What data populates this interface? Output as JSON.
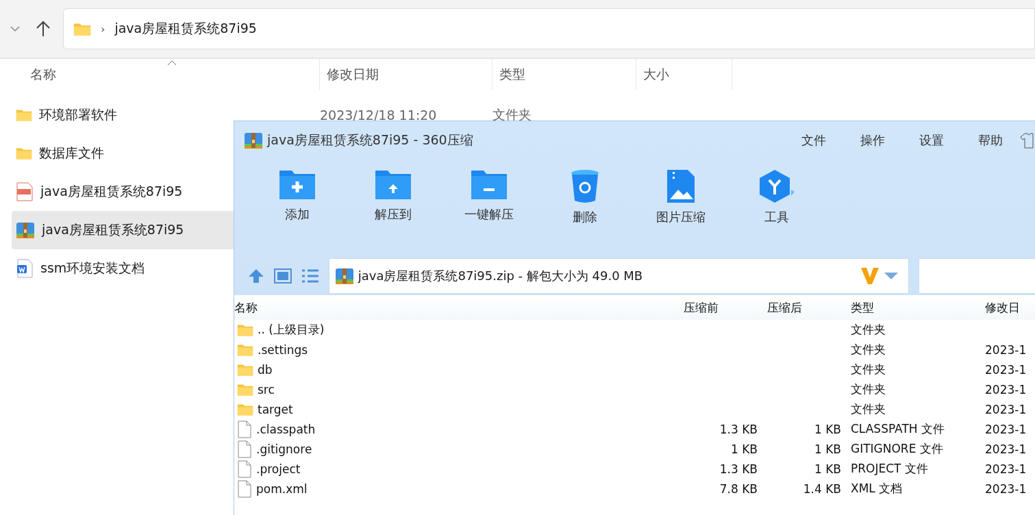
{
  "explorer": {
    "address": {
      "separator": "›",
      "path": "java房屋租赁系统87i95"
    },
    "columns": [
      "名称",
      "修改日期",
      "类型",
      "大小"
    ],
    "items": [
      {
        "kind": "folder",
        "name": "环境部署软件",
        "date": "2023/12/18 11:20",
        "type": "文件夹",
        "selected": false
      },
      {
        "kind": "folder",
        "name": "数据库文件",
        "selected": false
      },
      {
        "kind": "mp4",
        "name": "java房屋租赁系统87i95",
        "selected": false
      },
      {
        "kind": "zip",
        "name": "java房屋租赁系统87i95",
        "selected": true
      },
      {
        "kind": "word",
        "name": "ssm环境安装文档",
        "selected": false
      }
    ]
  },
  "archiver": {
    "title": "java房屋租赁系统87i95 - 360压缩",
    "menu": [
      "文件",
      "操作",
      "设置",
      "帮助"
    ],
    "tools": [
      {
        "kind": "add",
        "label": "添加"
      },
      {
        "kind": "extract",
        "label": "解压到"
      },
      {
        "kind": "quick",
        "label": "一键解压"
      },
      {
        "kind": "delete",
        "label": "删除"
      },
      {
        "kind": "image",
        "label": "图片压缩"
      },
      {
        "kind": "tools",
        "label": "工具"
      }
    ],
    "path": "java房屋租赁系统87i95.zip - 解包大小为 49.0 MB",
    "columns": [
      "名称",
      "压缩前",
      "压缩后",
      "类型",
      "修改日"
    ],
    "rows": [
      {
        "kind": "folder",
        "name": ".. (上级目录)",
        "type": "文件夹"
      },
      {
        "kind": "folder",
        "name": ".settings",
        "type": "文件夹",
        "date": "2023-1"
      },
      {
        "kind": "folder",
        "name": "db",
        "type": "文件夹",
        "date": "2023-1"
      },
      {
        "kind": "folder",
        "name": "src",
        "type": "文件夹",
        "date": "2023-1"
      },
      {
        "kind": "folder",
        "name": "target",
        "type": "文件夹",
        "date": "2023-1"
      },
      {
        "kind": "file",
        "name": ".classpath",
        "before": "1.3 KB",
        "after": "1 KB",
        "type": "CLASSPATH 文件",
        "date": "2023-1"
      },
      {
        "kind": "file",
        "name": ".gitignore",
        "before": "1 KB",
        "after": "1 KB",
        "type": "GITIGNORE 文件",
        "date": "2023-1"
      },
      {
        "kind": "file",
        "name": ".project",
        "before": "1.3 KB",
        "after": "1 KB",
        "type": "PROJECT 文件",
        "date": "2023-1"
      },
      {
        "kind": "file",
        "name": "pom.xml",
        "before": "7.8 KB",
        "after": "1.4 KB",
        "type": "XML 文档",
        "date": "2023-1"
      }
    ]
  }
}
